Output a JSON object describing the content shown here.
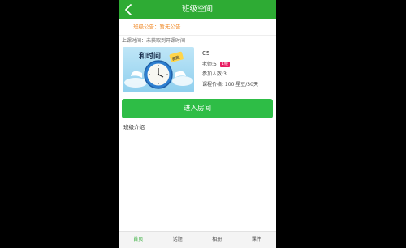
{
  "header": {
    "title": "班级空间"
  },
  "notice": {
    "text": "班级公告：暂无公告"
  },
  "schedule": {
    "text": "上课时间：未获取到开课时间"
  },
  "class_info": {
    "name": "C5",
    "teacher_label": "老师:5",
    "level_badge": "1级",
    "participants": "参加人数:3",
    "price": "课程价格: 100 星豆/30天"
  },
  "thumbnail": {
    "text": "和时间",
    "badge": "赛跑"
  },
  "enter_button": {
    "label": "进入房间"
  },
  "intro": {
    "label": "班级介绍"
  },
  "tabs": [
    {
      "label": "首页",
      "active": true
    },
    {
      "label": "话题",
      "active": false
    },
    {
      "label": "相册",
      "active": false
    },
    {
      "label": "课件",
      "active": false
    }
  ],
  "colors": {
    "primary": "#2eab34",
    "notice": "#f08a28",
    "badge": "#e91e63"
  }
}
